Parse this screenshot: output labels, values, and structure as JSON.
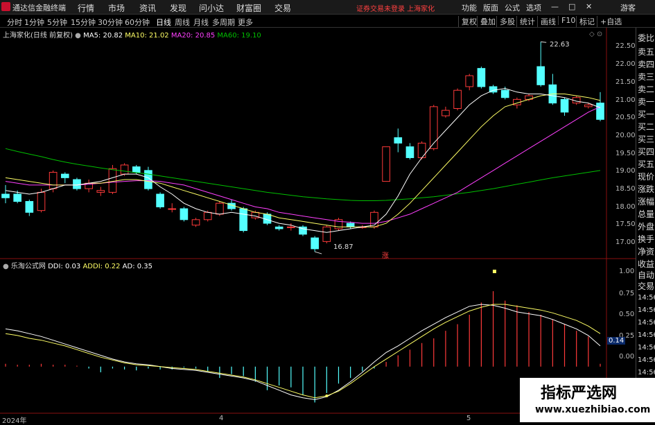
{
  "menubar": {
    "app_title": "通达信金融终端",
    "items": [
      "行情",
      "市场",
      "资讯",
      "发现",
      "问小达",
      "财富圈",
      "交易"
    ],
    "notice": "证券交易未登录  上海家化",
    "right_items": [
      "功能",
      "版面",
      "公式",
      "选项"
    ],
    "guest": "游客"
  },
  "periods": [
    "分时",
    "1分钟",
    "5分钟",
    "15分钟",
    "30分钟",
    "60分钟",
    "日线",
    "周线",
    "月线",
    "多周期",
    "更多"
  ],
  "tools": [
    "复权",
    "叠加",
    "多股",
    "统计",
    "画线",
    "F10",
    "标记",
    "+自选"
  ],
  "main_info": {
    "title": "上海家化(日线 前复权)",
    "ma5": "MA5: 20.82",
    "ma10": "MA10: 21.02",
    "ma20": "MA20: 20.85",
    "ma60": "MA60: 19.10"
  },
  "sub_info": {
    "title": "乐淘公式网",
    "ddi": "DDI: 0.03",
    "addi": "ADDI: 0.22",
    "ad": "AD: 0.35"
  },
  "price_axis": [
    "22.50",
    "22.00",
    "21.50",
    "21.00",
    "20.50",
    "20.00",
    "19.50",
    "19.00",
    "18.50",
    "18.00",
    "17.50",
    "17.00"
  ],
  "sub_axis": [
    "1.00",
    "0.75",
    "0.50",
    "0.25",
    "0.00"
  ],
  "sub_current": "0.14",
  "annotations": {
    "high": "22.63",
    "low": "16.87",
    "zhang": "涨"
  },
  "date_labels": [
    "2024年",
    "4",
    "5"
  ],
  "right_panel": [
    "委比",
    "卖五",
    "卖四",
    "卖三",
    "卖二",
    "卖一",
    "买一",
    "买二",
    "买三",
    "买四",
    "买五",
    "现价",
    "涨跌",
    "涨幅",
    "总量",
    "外盘",
    "换手",
    "净资",
    "收益",
    "自动",
    "交易"
  ],
  "right_times": [
    "14:56",
    "14:56",
    "14:56",
    "14:56",
    "14:56",
    "14:56",
    "14:56"
  ],
  "watermark": {
    "line1": "指标严选网",
    "line2": "www.xuezhibiao.com"
  },
  "colors": {
    "up": "#ff3a3a",
    "down": "#54ffff",
    "ma5": "#ffffff",
    "ma10": "#ffff66",
    "ma20": "#ff40ff",
    "ma60": "#00c000"
  },
  "chart_data": {
    "type": "candlestick",
    "candles": [
      {
        "o": 18.45,
        "c": 18.35,
        "h": 18.7,
        "l": 18.2
      },
      {
        "o": 18.45,
        "c": 18.25,
        "h": 18.55,
        "l": 18.2
      },
      {
        "o": 18.25,
        "c": 17.95,
        "h": 18.3,
        "l": 17.85
      },
      {
        "o": 18.0,
        "c": 18.5,
        "h": 18.6,
        "l": 17.95
      },
      {
        "o": 18.6,
        "c": 19.05,
        "h": 19.1,
        "l": 18.5
      },
      {
        "o": 19.0,
        "c": 18.9,
        "h": 19.05,
        "l": 18.75
      },
      {
        "o": 18.85,
        "c": 18.6,
        "h": 18.9,
        "l": 18.55
      },
      {
        "o": 18.6,
        "c": 18.75,
        "h": 18.85,
        "l": 18.5
      },
      {
        "o": 18.5,
        "c": 18.55,
        "h": 18.65,
        "l": 18.4
      },
      {
        "o": 18.5,
        "c": 19.15,
        "h": 19.25,
        "l": 18.45
      },
      {
        "o": 19.0,
        "c": 19.25,
        "h": 19.3,
        "l": 18.95
      },
      {
        "o": 19.2,
        "c": 19.05,
        "h": 19.25,
        "l": 19.0
      },
      {
        "o": 19.1,
        "c": 18.6,
        "h": 19.2,
        "l": 18.55
      },
      {
        "o": 18.45,
        "c": 18.1,
        "h": 18.5,
        "l": 18.05
      },
      {
        "o": 18.05,
        "c": 18.05,
        "h": 18.2,
        "l": 17.95
      },
      {
        "o": 18.05,
        "c": 17.75,
        "h": 18.1,
        "l": 17.7
      },
      {
        "o": 17.6,
        "c": 17.75,
        "h": 17.8,
        "l": 17.55
      },
      {
        "o": 17.75,
        "c": 17.95,
        "h": 18.0,
        "l": 17.7
      },
      {
        "o": 17.9,
        "c": 18.2,
        "h": 18.25,
        "l": 17.85
      },
      {
        "o": 18.2,
        "c": 18.05,
        "h": 18.3,
        "l": 18.0
      },
      {
        "o": 18.05,
        "c": 17.45,
        "h": 18.1,
        "l": 17.4
      },
      {
        "o": 17.8,
        "c": 17.95,
        "h": 18.0,
        "l": 17.75
      },
      {
        "o": 17.9,
        "c": 17.65,
        "h": 17.95,
        "l": 17.6
      },
      {
        "o": 17.55,
        "c": 17.5,
        "h": 17.6,
        "l": 17.45
      },
      {
        "o": 17.55,
        "c": 17.55,
        "h": 17.65,
        "l": 17.45
      },
      {
        "o": 17.55,
        "c": 17.35,
        "h": 17.6,
        "l": 17.3
      },
      {
        "o": 17.25,
        "c": 16.95,
        "h": 17.3,
        "l": 16.87
      },
      {
        "o": 17.15,
        "c": 17.55,
        "h": 17.6,
        "l": 17.1
      },
      {
        "o": 17.5,
        "c": 17.75,
        "h": 17.8,
        "l": 17.45
      },
      {
        "o": 17.65,
        "c": 17.55,
        "h": 17.7,
        "l": 17.5
      },
      {
        "o": 17.55,
        "c": 17.55,
        "h": 17.6,
        "l": 17.5
      },
      {
        "o": 17.55,
        "c": 17.95,
        "h": 18.0,
        "l": 17.5
      },
      {
        "o": 18.8,
        "c": 19.75,
        "h": 19.75,
        "l": 18.8
      },
      {
        "o": 20.0,
        "c": 19.85,
        "h": 20.25,
        "l": 19.6
      },
      {
        "o": 19.75,
        "c": 19.45,
        "h": 19.85,
        "l": 19.4
      },
      {
        "o": 19.45,
        "c": 19.85,
        "h": 19.9,
        "l": 19.4
      },
      {
        "o": 19.7,
        "c": 20.85,
        "h": 20.9,
        "l": 19.65
      },
      {
        "o": 20.6,
        "c": 20.75,
        "h": 20.85,
        "l": 20.55
      },
      {
        "o": 20.8,
        "c": 21.3,
        "h": 21.35,
        "l": 20.75
      },
      {
        "o": 21.4,
        "c": 21.7,
        "h": 21.75,
        "l": 21.3
      },
      {
        "o": 21.9,
        "c": 21.4,
        "h": 21.95,
        "l": 21.35
      },
      {
        "o": 21.4,
        "c": 21.25,
        "h": 21.45,
        "l": 21.2
      },
      {
        "o": 21.3,
        "c": 21.1,
        "h": 21.4,
        "l": 21.05
      },
      {
        "o": 20.9,
        "c": 21.05,
        "h": 21.1,
        "l": 20.8
      },
      {
        "o": 21.05,
        "c": 21.15,
        "h": 21.2,
        "l": 21.0
      },
      {
        "o": 21.95,
        "c": 21.45,
        "h": 22.63,
        "l": 21.4
      },
      {
        "o": 21.45,
        "c": 20.95,
        "h": 21.75,
        "l": 20.9
      },
      {
        "o": 21.05,
        "c": 20.7,
        "h": 21.1,
        "l": 20.6
      },
      {
        "o": 20.95,
        "c": 21.1,
        "h": 21.15,
        "l": 20.9
      },
      {
        "o": 20.85,
        "c": 20.9,
        "h": 20.95,
        "l": 20.8
      },
      {
        "o": 20.95,
        "c": 20.5,
        "h": 21.25,
        "l": 20.45
      }
    ],
    "ma5": [
      18.55,
      18.5,
      18.45,
      18.5,
      18.6,
      18.7,
      18.7,
      18.75,
      18.8,
      18.9,
      19.0,
      19.0,
      18.9,
      18.65,
      18.45,
      18.2,
      18.05,
      17.95,
      17.9,
      17.95,
      17.9,
      17.85,
      17.75,
      17.65,
      17.6,
      17.5,
      17.45,
      17.4,
      17.45,
      17.5,
      17.55,
      17.6,
      17.9,
      18.4,
      19.0,
      19.45,
      19.85,
      20.2,
      20.55,
      20.9,
      21.15,
      21.3,
      21.35,
      21.25,
      21.2,
      21.2,
      21.15,
      21.1,
      21.0,
      20.95,
      20.82
    ],
    "ma10": [
      18.9,
      18.85,
      18.8,
      18.75,
      18.7,
      18.7,
      18.7,
      18.75,
      18.75,
      18.8,
      18.85,
      18.85,
      18.8,
      18.75,
      18.65,
      18.55,
      18.45,
      18.35,
      18.25,
      18.15,
      18.05,
      17.95,
      17.9,
      17.8,
      17.75,
      17.7,
      17.65,
      17.6,
      17.55,
      17.55,
      17.55,
      17.55,
      17.65,
      17.9,
      18.2,
      18.55,
      18.9,
      19.25,
      19.6,
      19.95,
      20.3,
      20.6,
      20.85,
      20.95,
      21.05,
      21.15,
      21.2,
      21.2,
      21.15,
      21.1,
      21.02
    ],
    "ma20": [
      18.8,
      18.75,
      18.7,
      18.7,
      18.7,
      18.7,
      18.7,
      18.72,
      18.75,
      18.78,
      18.8,
      18.82,
      18.82,
      18.8,
      18.75,
      18.7,
      18.6,
      18.5,
      18.4,
      18.3,
      18.2,
      18.1,
      18.05,
      17.95,
      17.9,
      17.85,
      17.8,
      17.75,
      17.7,
      17.68,
      17.65,
      17.65,
      17.7,
      17.8,
      17.9,
      18.05,
      18.2,
      18.35,
      18.5,
      18.7,
      18.9,
      19.1,
      19.3,
      19.5,
      19.7,
      19.9,
      20.1,
      20.3,
      20.5,
      20.7,
      20.85
    ],
    "ma60": [
      19.7,
      19.62,
      19.55,
      19.48,
      19.4,
      19.33,
      19.27,
      19.22,
      19.17,
      19.12,
      19.08,
      19.04,
      19.0,
      18.95,
      18.9,
      18.85,
      18.8,
      18.75,
      18.7,
      18.65,
      18.6,
      18.55,
      18.5,
      18.46,
      18.42,
      18.38,
      18.35,
      18.32,
      18.3,
      18.28,
      18.27,
      18.27,
      18.28,
      18.3,
      18.32,
      18.35,
      18.38,
      18.42,
      18.46,
      18.5,
      18.55,
      18.6,
      18.66,
      18.72,
      18.78,
      18.84,
      18.9,
      18.95,
      19.0,
      19.05,
      19.1
    ],
    "ddi_bars": [
      0.03,
      0.02,
      0.02,
      0.03,
      0.02,
      0.02,
      0.01,
      -0.02,
      -0.06,
      -0.02,
      -0.03,
      -0.04,
      -0.02,
      -0.03,
      -0.03,
      -0.01,
      -0.02,
      -0.05,
      -0.12,
      -0.08,
      -0.1,
      -0.16,
      -0.25,
      -0.2,
      -0.22,
      -0.3,
      -0.38,
      -0.28,
      -0.18,
      -0.12,
      -0.05,
      -0.02,
      0.05,
      0.12,
      0.18,
      0.25,
      0.3,
      0.38,
      0.45,
      0.55,
      0.68,
      0.8,
      0.7,
      0.65,
      0.58,
      0.55,
      0.5,
      0.45,
      0.38,
      0.32,
      0.03
    ],
    "addi": [
      0.4,
      0.38,
      0.35,
      0.32,
      0.28,
      0.24,
      0.2,
      0.16,
      0.12,
      0.08,
      0.05,
      0.03,
      0.02,
      0.0,
      -0.02,
      -0.03,
      -0.04,
      -0.06,
      -0.08,
      -0.1,
      -0.12,
      -0.15,
      -0.2,
      -0.25,
      -0.3,
      -0.33,
      -0.35,
      -0.32,
      -0.25,
      -0.16,
      -0.06,
      0.05,
      0.15,
      0.22,
      0.3,
      0.38,
      0.45,
      0.52,
      0.58,
      0.64,
      0.66,
      0.65,
      0.62,
      0.58,
      0.56,
      0.54,
      0.5,
      0.45,
      0.4,
      0.33,
      0.22
    ],
    "ad": [
      0.35,
      0.33,
      0.3,
      0.28,
      0.25,
      0.22,
      0.18,
      0.14,
      0.1,
      0.07,
      0.04,
      0.02,
      0.01,
      0.0,
      -0.01,
      -0.02,
      -0.03,
      -0.05,
      -0.07,
      -0.09,
      -0.11,
      -0.14,
      -0.18,
      -0.22,
      -0.26,
      -0.3,
      -0.33,
      -0.31,
      -0.26,
      -0.18,
      -0.09,
      0.0,
      0.08,
      0.16,
      0.24,
      0.32,
      0.4,
      0.47,
      0.53,
      0.59,
      0.63,
      0.66,
      0.66,
      0.64,
      0.62,
      0.6,
      0.57,
      0.53,
      0.49,
      0.43,
      0.35
    ],
    "price_range": [
      16.7,
      22.75
    ],
    "sub_range": [
      -0.45,
      1.05
    ]
  }
}
